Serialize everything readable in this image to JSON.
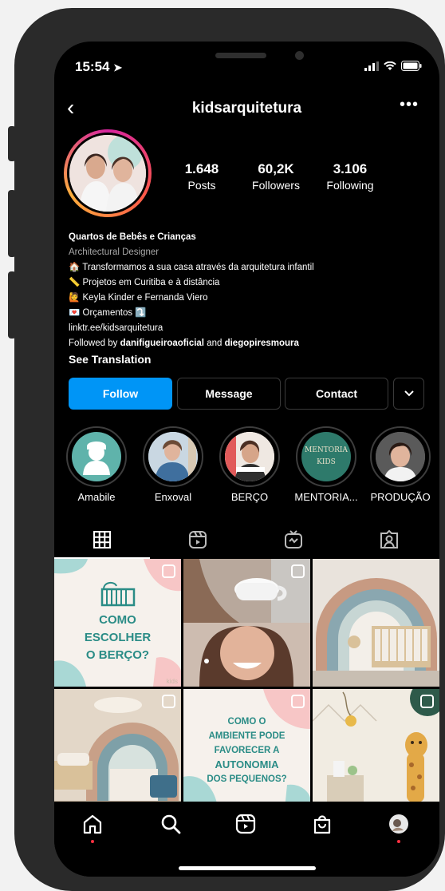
{
  "status": {
    "time": "15:54"
  },
  "header": {
    "username": "kidsarquitetura"
  },
  "stats": [
    {
      "value": "1.648",
      "label": "Posts"
    },
    {
      "value": "60,2K",
      "label": "Followers"
    },
    {
      "value": "3.106",
      "label": "Following"
    }
  ],
  "bio": {
    "name": "Quartos de Bebês e Crianças",
    "category": "Architectural Designer",
    "lines": [
      "🏠 Transformamos a sua casa através da arquitetura infantil",
      "📏 Projetos em Curitiba e à distância",
      "🙋 Keyla Kinder e Fernanda Viero",
      "💌 Orçamentos ⤵️"
    ],
    "link": "linktr.ee/kidsarquitetura",
    "followed_prefix": "Followed by ",
    "followed_a": "danifigueiroaoficial",
    "followed_and": " and ",
    "followed_b": "diegopiresmoura",
    "see_translation": "See Translation"
  },
  "buttons": {
    "follow": "Follow",
    "message": "Message",
    "contact": "Contact"
  },
  "highlights": [
    {
      "label": "Amabile"
    },
    {
      "label": "Enxoval"
    },
    {
      "label": "BERÇO"
    },
    {
      "label": "MENTORIA...",
      "badge_line1": "MENTORIA",
      "badge_line2": "KIDS"
    },
    {
      "label": "PRODUÇÃO"
    }
  ],
  "posts": [
    {
      "text_lines": [
        "COMO",
        "ESCOLHER",
        "O BERÇO?"
      ],
      "brand": "kids"
    },
    {
      "text_lines": []
    },
    {
      "text_lines": []
    },
    {
      "text_lines": []
    },
    {
      "text_lines": [
        "COMO O",
        "AMBIENTE PODE",
        "FAVORECER A",
        "AUTONOMIA",
        "DOS PEQUENOS?"
      ]
    },
    {
      "text_lines": []
    }
  ],
  "colors": {
    "follow": "#0095f6",
    "background": "#000000",
    "notification": "#ff3040"
  },
  "icons": [
    "back-icon",
    "more-icon",
    "grid-icon",
    "reels-icon",
    "igtv-icon",
    "tagged-icon",
    "home-icon",
    "search-icon",
    "shop-icon",
    "profile-icon",
    "signal-icon",
    "wifi-icon",
    "battery-icon"
  ]
}
